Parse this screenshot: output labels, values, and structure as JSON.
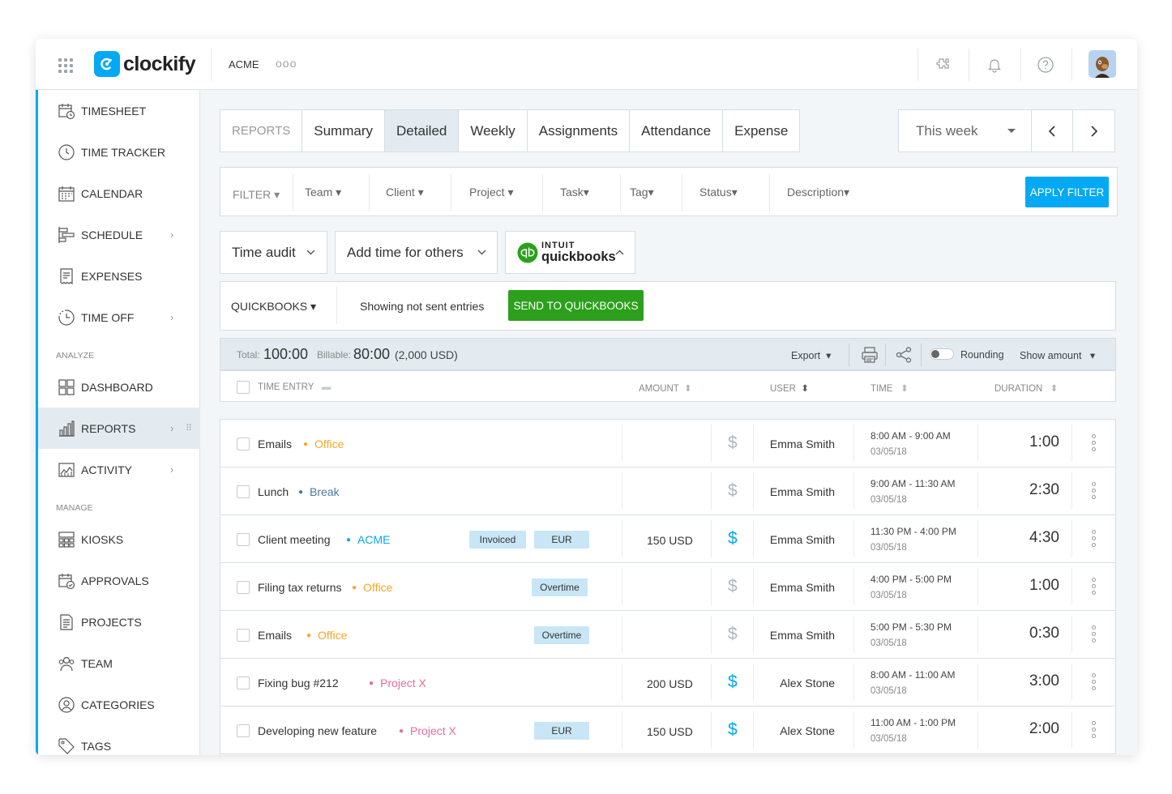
{
  "topbar": {
    "logo_text": "clockify",
    "workspace": "ACME",
    "more": "ooo",
    "icons": [
      "extensions-icon",
      "bell-icon",
      "help-icon",
      "avatar"
    ]
  },
  "sidebar": {
    "items": [
      {
        "label": "TIMESHEET",
        "icon": "timesheet-icon"
      },
      {
        "label": "TIME TRACKER",
        "icon": "clock-icon"
      },
      {
        "label": "CALENDAR",
        "icon": "calendar-icon"
      },
      {
        "label": "SCHEDULE",
        "icon": "schedule-icon",
        "chevron": "›"
      },
      {
        "label": "EXPENSES",
        "icon": "receipt-icon"
      },
      {
        "label": "TIME OFF",
        "icon": "time-off-icon",
        "chevron": "›"
      }
    ],
    "analyze_label": "ANALYZE",
    "analyze": [
      {
        "label": "DASHBOARD",
        "icon": "dashboard-icon"
      },
      {
        "label": "REPORTS",
        "icon": "reports-icon",
        "chevron": "›",
        "drag": "⠿"
      },
      {
        "label": "ACTIVITY",
        "icon": "activity-icon",
        "chevron": "›"
      }
    ],
    "manage_label": "MANAGE",
    "manage": [
      {
        "label": "KIOSKS",
        "icon": "kiosk-icon"
      },
      {
        "label": "APPROVALS",
        "icon": "approvals-icon"
      },
      {
        "label": "PROJECTS",
        "icon": "projects-icon"
      },
      {
        "label": "TEAM",
        "icon": "team-icon"
      },
      {
        "label": "CATEGORIES",
        "icon": "categories-icon"
      },
      {
        "label": "TAGS",
        "icon": "tag-icon"
      }
    ]
  },
  "tabs": [
    "REPORTS",
    "Summary",
    "Detailed",
    "Weekly",
    "Assignments",
    "Attendance",
    "Expense"
  ],
  "selected_tab": "Detailed",
  "date_range": "This week",
  "filter": {
    "label": "FILTER",
    "items": [
      "Team",
      "Client",
      "Project",
      "Task",
      "Tag",
      "Status",
      "Description"
    ],
    "apply": "APPLY FILTER"
  },
  "dropdowns": {
    "time_audit": "Time audit",
    "add_time": "Add time for others",
    "intuit": "INTUIT",
    "quickbooks": "quickbooks"
  },
  "qb_bar": {
    "label": "QUICKBOOKS",
    "showing": "Showing not sent entries",
    "send": "SEND TO QUICKBOOKS"
  },
  "summary": {
    "total_label": "Total:",
    "total": "100:00",
    "billable_label": "Billable:",
    "billable": "80:00",
    "billable_amount": "(2,000 USD)",
    "export": "Export",
    "rounding": "Rounding",
    "show_amount": "Show amount"
  },
  "columns": {
    "time_entry": "TIME ENTRY",
    "amount": "AMOUNT",
    "user": "USER",
    "time": "TIME",
    "duration": "DURATION"
  },
  "colors": {
    "accent": "#03a9f4",
    "green": "#2ca01c",
    "office": "#f5a623",
    "break": "#4a7a9a",
    "acme": "#03a9f4",
    "projectx": "#ec6a9b"
  },
  "entries": [
    {
      "desc": "Emails",
      "project": "Office",
      "color": "#f5a623",
      "tags": [],
      "amount": "",
      "billable": false,
      "user": "Emma Smith",
      "time": "8:00 AM - 9:00 AM",
      "date": "03/05/18",
      "duration": "1:00"
    },
    {
      "desc": "Lunch",
      "project": "Break",
      "color": "#4a7a9a",
      "tags": [],
      "amount": "",
      "billable": false,
      "user": "Emma Smith",
      "time": "9:00 AM - 11:30 AM",
      "date": "03/05/18",
      "duration": "2:30"
    },
    {
      "desc": "Client meeting",
      "project": "ACME",
      "color": "#03a9f4",
      "tags": [
        "Invoiced",
        "EUR"
      ],
      "amount": "150 USD",
      "billable": true,
      "user": "Emma Smith",
      "time": "11:30 PM - 4:00 PM",
      "date": "03/05/18",
      "duration": "4:30"
    },
    {
      "desc": "Filing tax returns",
      "project": "Office",
      "color": "#f5a623",
      "tags": [
        "Overtime"
      ],
      "amount": "",
      "billable": false,
      "user": "Emma Smith",
      "time": "4:00 PM - 5:00 PM",
      "date": "03/05/18",
      "duration": "1:00"
    },
    {
      "desc": "Emails",
      "project": "Office",
      "color": "#f5a623",
      "tags": [
        "Overtime"
      ],
      "amount": "",
      "billable": false,
      "user": "Emma Smith",
      "time": "5:00 PM - 5:30 PM",
      "date": "03/05/18",
      "duration": "0:30"
    },
    {
      "desc": "Fixing bug #212",
      "project": "Project X",
      "color": "#ec6a9b",
      "tags": [],
      "amount": "200 USD",
      "billable": true,
      "user": "Alex Stone",
      "time": "8:00 AM - 11:00 AM",
      "date": "03/05/18",
      "duration": "3:00"
    },
    {
      "desc": "Developing new feature",
      "project": "Project X",
      "color": "#ec6a9b",
      "tags": [
        "EUR"
      ],
      "amount": "150 USD",
      "billable": true,
      "user": "Alex Stone",
      "time": "11:00 AM - 1:00 PM",
      "date": "03/05/18",
      "duration": "2:00"
    }
  ]
}
